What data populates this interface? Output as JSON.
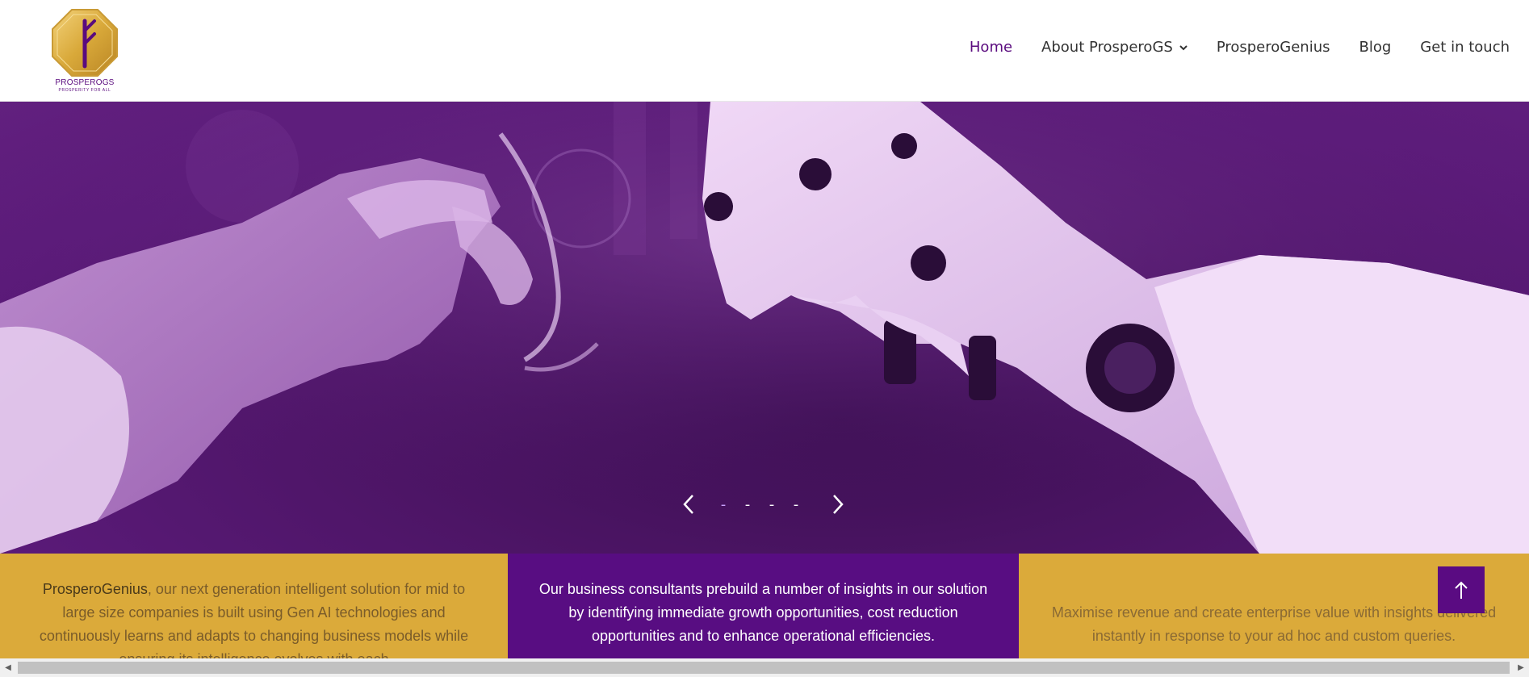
{
  "logo": {
    "brand": "PROSPEROGS",
    "tagline": "PROSPERITY FOR ALL",
    "colors": {
      "gold": "#d9a93a",
      "purple": "#5a0b7e"
    }
  },
  "nav": {
    "items": [
      {
        "label": "Home",
        "active": true
      },
      {
        "label": "About ProsperoGS",
        "has_dropdown": true
      },
      {
        "label": "ProsperoGenius"
      },
      {
        "label": "Blog"
      },
      {
        "label": "Get in touch"
      }
    ]
  },
  "hero": {
    "slides_total": 4,
    "active_slide": 1,
    "dot_glyph": "-",
    "overlay_color": "#5a1a78"
  },
  "cards": {
    "left": {
      "strong": "ProsperoGenius",
      "text": ", our next generation intelligent solution for mid to large size companies is built using Gen AI technologies and continuously learns and adapts to changing business models while ensuring its intelligence evolves with each"
    },
    "mid": {
      "text": "Our business consultants prebuild a number of insights in our solution by identifying immediate growth opportunities, cost reduction opportunities and to enhance operational efficiencies."
    },
    "right": {
      "text": "Maximise revenue and create enterprise value with insights delivered instantly in response to your ad hoc and custom queries."
    }
  },
  "colors": {
    "brand_purple": "#580d82",
    "gold": "#dbaa3a",
    "active_nav": "#5a0b7e"
  },
  "icons": {
    "back_to_top": "arrow-up-icon",
    "prev": "chevron-left-icon",
    "next": "chevron-right-icon"
  }
}
